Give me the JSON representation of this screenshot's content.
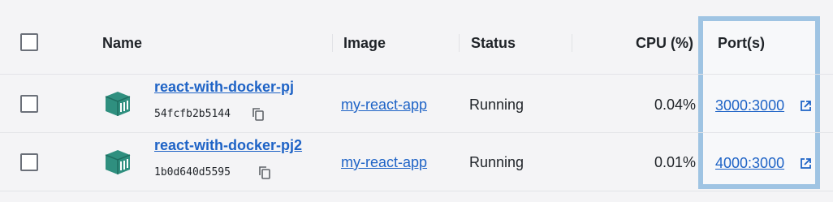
{
  "header": {
    "name": "Name",
    "image": "Image",
    "status": "Status",
    "cpu": "CPU (%)",
    "ports": "Port(s)"
  },
  "rows": [
    {
      "name": "react-with-docker-pj",
      "id": "54fcfb2b5144",
      "image": "my-react-app",
      "status": "Running",
      "cpu": "0.04%",
      "port": "3000:3000"
    },
    {
      "name": "react-with-docker-pj2",
      "id": "1b0d640d5595",
      "image": "my-react-app",
      "status": "Running",
      "cpu": "0.01%",
      "port": "4000:3000"
    }
  ],
  "colors": {
    "link": "#1e63c6",
    "container_icon": "#2f8f7f",
    "highlight_border": "#9fc4e3"
  },
  "icons": {
    "container": "container-box-icon",
    "copy": "copy-icon",
    "external": "external-link-icon"
  }
}
